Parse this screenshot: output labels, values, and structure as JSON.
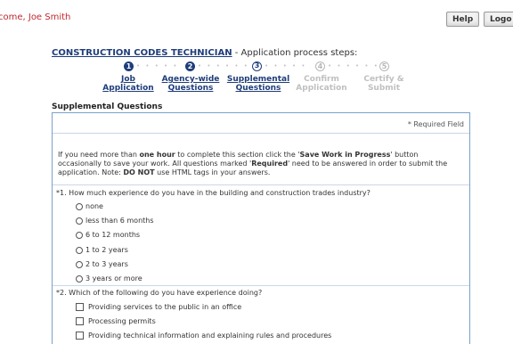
{
  "header": {
    "welcome_text": "come, Joe Smith",
    "help_label": "Help",
    "logout_label": "Logo"
  },
  "process": {
    "position_title": "CONSTRUCTION CODES TECHNICIAN",
    "separator_text": " - Application process steps:",
    "steps": [
      {
        "number": "1",
        "line1": "Job",
        "line2": "Application",
        "state": "completed"
      },
      {
        "number": "2",
        "line1": "Agency-wide",
        "line2": "Questions",
        "state": "completed"
      },
      {
        "number": "3",
        "line1": "Supplemental",
        "line2": "Questions",
        "state": "current"
      },
      {
        "number": "4",
        "line1": "Confirm",
        "line2": "Application",
        "state": "upcoming"
      },
      {
        "number": "5",
        "line1": "Certify &",
        "line2": "Submit",
        "state": "upcoming"
      }
    ]
  },
  "section": {
    "title": "Supplemental Questions",
    "required_note": "* Required Field",
    "intro": {
      "p1": "If you need more than ",
      "b1": "one hour",
      "p2": " to complete this section click the '",
      "b2": "Save Work in Progress",
      "p3": "' button occasionally to save your work. All questions marked '",
      "b3": "Required",
      "p4": "' need to be answered in order to submit the application. Note: ",
      "b4": "DO NOT",
      "p5": " use HTML tags in your answers."
    }
  },
  "questions": [
    {
      "text": "*1. How much experience do you have in the building and construction trades industry?",
      "options": [
        "none",
        "less than 6 months",
        "6 to 12 months",
        "1 to 2 years",
        "2 to 3 years",
        "3 years or more"
      ]
    },
    {
      "text": "*2. Which of the following do you have experience doing?",
      "options": [
        "Providing services to the public in an office",
        "Processing permits",
        "Providing technical information and explaining rules and procedures"
      ]
    }
  ],
  "colors": {
    "accent": "#1f3d7a",
    "welcome": "#c0292f",
    "panel_border": "#7aa2c8"
  }
}
